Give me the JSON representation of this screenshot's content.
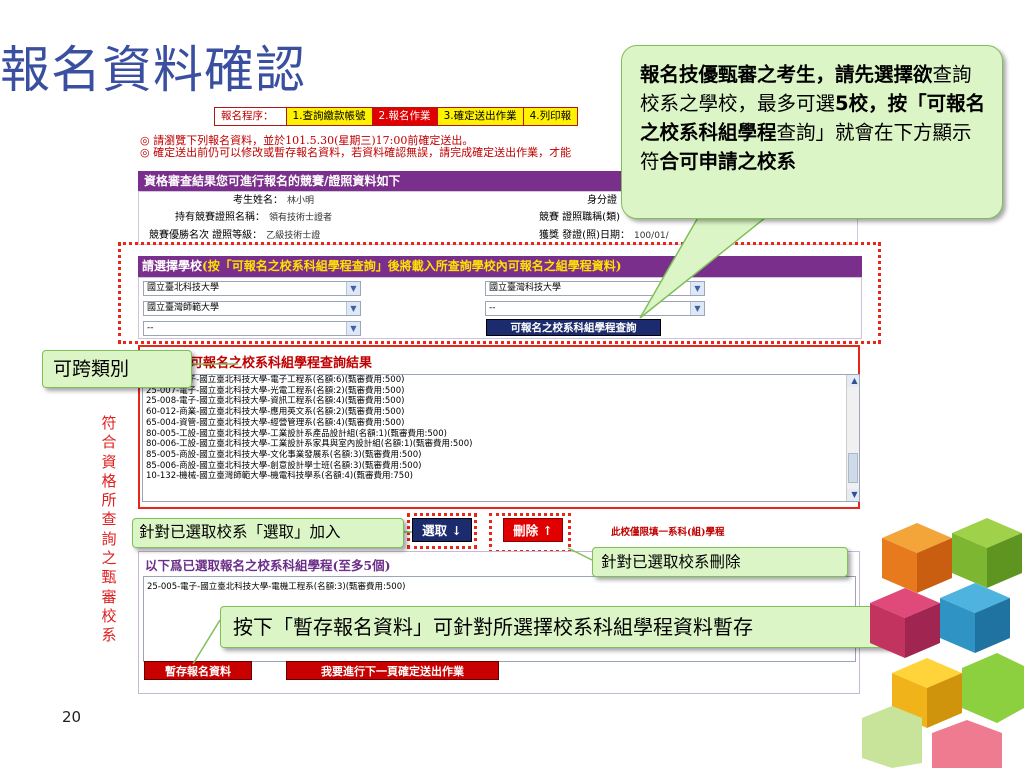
{
  "slide": {
    "title": "報名資料確認",
    "page_number": "20"
  },
  "steps": {
    "label": "報名程序：",
    "items": [
      "1.查詢繳款帳號",
      "2.報名作業",
      "3.確定送出作業",
      "4.列印報"
    ]
  },
  "notice": {
    "line1": "◎ 請瀏覽下列報名資料，並於101.5.30(星期三)17:00前確定送出。",
    "line2": "◎ 確定送出前仍可以修改或暫存報名資料，若資料確認無誤，請完成確定送出作業，才能"
  },
  "qualification": {
    "heading": "資格審查結果您可進行報名的競賽/證照資料如下",
    "name_label": "考生姓名：",
    "name_value": "林小明",
    "id_label": "身分證",
    "cert_name_label": "持有競賽證照名稱：",
    "cert_name_value": "領有技術士證者",
    "job_label": "競賽 證照職稱(類)",
    "rank_label": "競賽優勝名次 證照等級：",
    "rank_value": "乙級技術士證",
    "date_label": "獲獎 發證(照)日期：",
    "date_value": "100/01/"
  },
  "school_select": {
    "heading_prefix": "請選擇學校",
    "heading_yellow": "(按「可報名之校系科組學程查詢」後將載入所查詢學校內可報名之",
    "heading_suffix": "組學程資料)",
    "dropdowns_left": [
      "國立臺北科技大學",
      "國立臺灣師範大學",
      "--"
    ],
    "dropdowns_right": [
      "國立臺灣科技大學",
      "--"
    ],
    "query_button": "可報名之校系科組學程查詢"
  },
  "results": {
    "heading": "可報名之校系科組學程查詢結果",
    "items": [
      "25-006-電子-國立臺北科技大學-電子工程系(名額:6)(甄審費用:500)",
      "25-007-電子-國立臺北科技大學-光電工程系(名額:2)(甄審費用:500)",
      "25-008-電子-國立臺北科技大學-資訊工程系(名額:4)(甄審費用:500)",
      "60-012-商業-國立臺北科技大學-應用英文系(名額:2)(甄審費用:500)",
      "65-004-資管-國立臺北科技大學-經營管理系(名額:4)(甄審費用:500)",
      "80-005-工設-國立臺北科技大學-工業設計系產品設計組(名額:1)(甄審費用:500)",
      "80-006-工設-國立臺北科技大學-工業設計系家具與室內設計組(名額:1)(甄審費用:500)",
      "85-005-商設-國立臺北科技大學-文化事業發展系(名額:3)(甄審費用:500)",
      "85-006-商設-國立臺北科技大學-創意設計學士班(名額:3)(甄審費用:500)",
      "10-132-機械-國立臺灣師範大學-機電科技學系(名額:4)(甄審費用:750)"
    ]
  },
  "actions": {
    "select_button": "選取 ↓",
    "delete_button": "刪除 ↑",
    "limit_note": "此校僅限填一系科(組)學程"
  },
  "chosen": {
    "heading": "以下爲已選取報名之校系科組學程(至多5個)",
    "items": [
      "25-005-電子-國立臺北科技大學-電機工程系(名額:3)(甄審費用:500)"
    ],
    "save_button": "暫存報名資料",
    "next_button": "我要進行下一頁確定送出作業"
  },
  "callouts": {
    "main_bold1": "報名技優甄審之考生，請先選擇欲",
    "main_normal1": "查詢校系之學校，最多可選",
    "main_bold2": "5校，按「可報名之校系科組學程",
    "main_normal2": "查詢」就會在下方顯示符",
    "main_bold3": "合可申請之校系",
    "cross_category": "可跨類別",
    "side_vertical": "符合資格所查詢之甄審校系",
    "pick_hint": "針對已選取校系「選取」加入",
    "delete_hint": "針對已選取校系刪除",
    "save_hint": "按下「暫存報名資料」可針對所選擇校系科組學程資料暫存"
  },
  "colors": {
    "title": "#3a4fa0",
    "header_purple": "#7b2f8c",
    "alert_red": "#e8261a",
    "callout_fill": "#dcf5c6",
    "callout_border": "#7fbf5a",
    "button_navy": "#1c2b6e"
  }
}
